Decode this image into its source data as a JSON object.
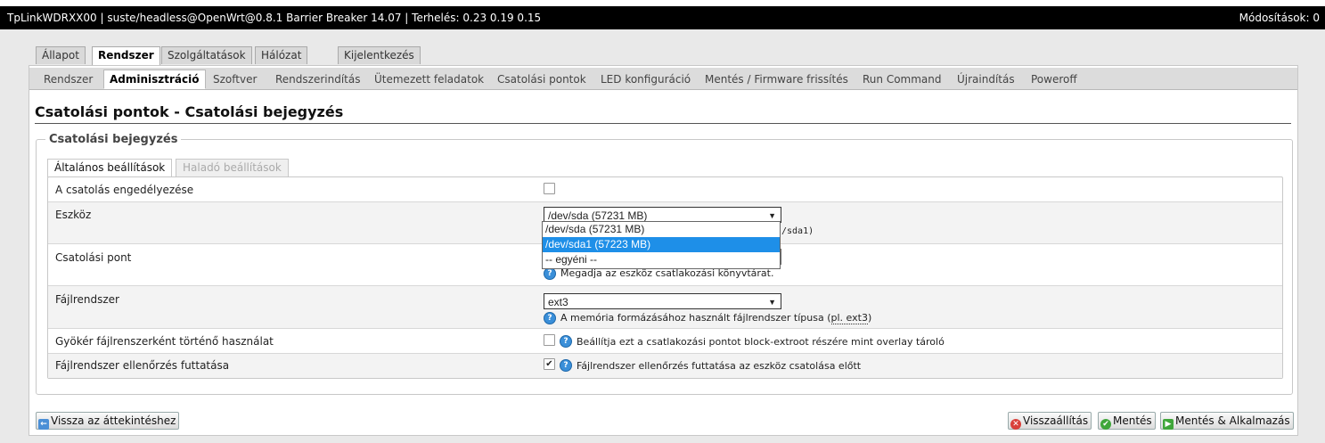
{
  "header": {
    "title": "TpLinkWDRXX00 | suste/headless@OpenWrt@0.8.1 Barrier Breaker 14.07 | Terhelés: 0.23 0.19 0.15",
    "changes": "Módosítások: 0"
  },
  "main_tabs": [
    "Állapot",
    "Rendszer",
    "Szolgáltatások",
    "Hálózat",
    "Kijelentkezés"
  ],
  "sub_tabs": [
    "Rendszer",
    "Adminisztráció",
    "Szoftver",
    "Rendszerindítás",
    "Ütemezett feladatok",
    "Csatolási pontok",
    "LED konfiguráció",
    "Mentés / Firmware frissítés",
    "Run Command",
    "Újraindítás",
    "Poweroff"
  ],
  "page_title": "Csatolási pontok - Csatolási bejegyzés",
  "fieldset_legend": "Csatolási bejegyzés",
  "inner_tabs": [
    "Általános beállítások",
    "Haladó beállítások"
  ],
  "rows": {
    "enable": {
      "label": "A csatolás engedélyezése",
      "checked": false
    },
    "device": {
      "label": "Eszköz",
      "value": "/dev/sda (57231 MB)",
      "hint_tail": "/sda1)"
    },
    "mountpoint": {
      "label": "Csatolási pont",
      "hint": "Megadja az eszköz csatlakozási könyvtárat."
    },
    "filesystem": {
      "label": "Fájlrendszer",
      "value": "ext3",
      "hint": "A memória formázásához használt fájlrendszer típusa (",
      "hint_abbr": "pl. ext3",
      "hint_end": ")"
    },
    "root": {
      "label": "Gyökér fájlrenszerként történő használat",
      "checked": false,
      "hint": "Beállítja ezt a csatlakozási pontot block-extroot részére mint overlay tároló"
    },
    "fsck": {
      "label": "Fájlrendszer ellenőrzés futtatása",
      "checked": true,
      "hint": "Fájlrendszer ellenőrzés futtatása az eszköz csatolása előtt"
    }
  },
  "dropdown_options": [
    "/dev/sda (57231 MB)",
    "/dev/sda1 (57223 MB)",
    "-- egyéni --"
  ],
  "dropdown_selected_index": 1,
  "footer": {
    "back": "Vissza az áttekintéshez",
    "reset": "Visszaállítás",
    "save": "Mentés",
    "save_apply": "Mentés & Alkalmazás"
  },
  "colors": {
    "header_bg": "#000000",
    "selected_option": "#1e8fe8",
    "help_icon": "#3a8fd9"
  }
}
